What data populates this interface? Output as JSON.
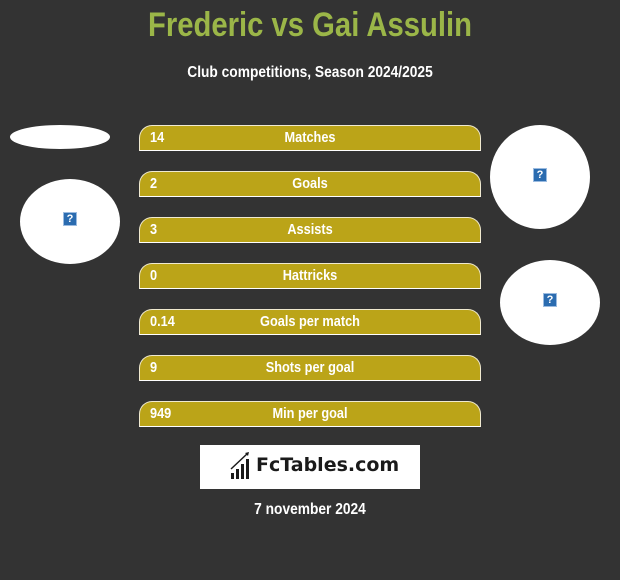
{
  "header": {
    "title": "Frederic vs Gai Assulin",
    "subtitle": "Club competitions, Season 2024/2025"
  },
  "colors": {
    "background": "#333333",
    "title": "#9bb648",
    "bar_fill": "#bba418",
    "text": "#ffffff"
  },
  "stats": [
    {
      "label": "Matches",
      "left_value": "14"
    },
    {
      "label": "Goals",
      "left_value": "2"
    },
    {
      "label": "Assists",
      "left_value": "3"
    },
    {
      "label": "Hattricks",
      "left_value": "0"
    },
    {
      "label": "Goals per match",
      "left_value": "0.14"
    },
    {
      "label": "Shots per goal",
      "left_value": "9"
    },
    {
      "label": "Min per goal",
      "left_value": "949"
    }
  ],
  "players": {
    "left": {
      "name": "Frederic",
      "image_icon": "broken-image-icon",
      "icon_glyph": "?"
    },
    "right": {
      "name": "Gai Assulin",
      "image_icon": "broken-image-icon",
      "icon_glyph": "?"
    }
  },
  "branding": {
    "logo_text": "FcTables.com",
    "logo_icon": "bar-chart-icon"
  },
  "footer": {
    "date": "7 november 2024"
  }
}
